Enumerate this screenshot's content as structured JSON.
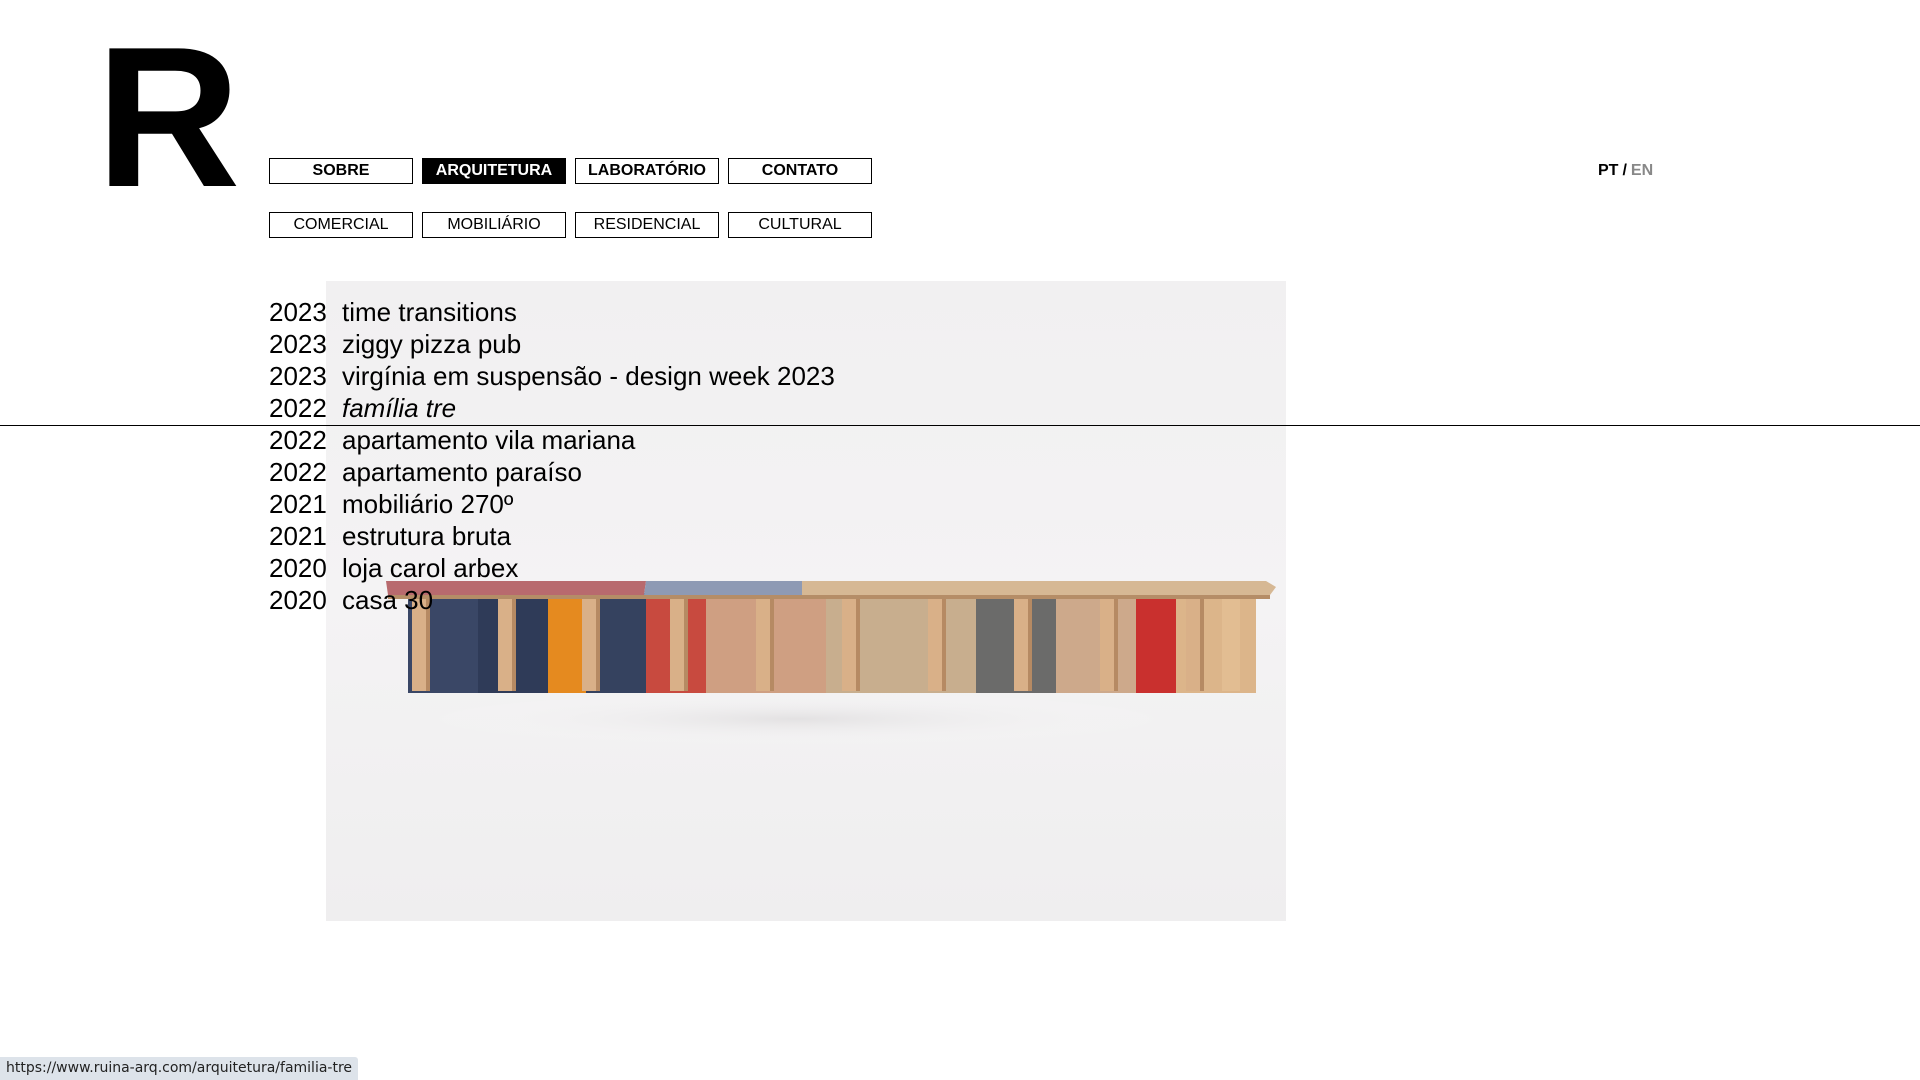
{
  "logo": "R",
  "nav": {
    "main": [
      {
        "label": "SOBRE",
        "active": false
      },
      {
        "label": "ARQUITETURA",
        "active": true
      },
      {
        "label": "LABORATÓRIO",
        "active": false
      },
      {
        "label": "CONTATO",
        "active": false
      }
    ],
    "sub": [
      {
        "label": "COMERCIAL"
      },
      {
        "label": "MOBILIÁRIO"
      },
      {
        "label": "RESIDENCIAL"
      },
      {
        "label": "CULTURAL"
      }
    ]
  },
  "language": {
    "current": "PT",
    "separator": "/",
    "other": "EN"
  },
  "projects": [
    {
      "year": "2023",
      "title": "time transitions",
      "hovered": false
    },
    {
      "year": "2023",
      "title": "ziggy pizza pub",
      "hovered": false
    },
    {
      "year": "2023",
      "title": "virgínia em suspensão - design week 2023",
      "hovered": false
    },
    {
      "year": "2022",
      "title": "família tre",
      "hovered": true
    },
    {
      "year": "2022",
      "title": "apartamento vila mariana",
      "hovered": false
    },
    {
      "year": "2022",
      "title": "apartamento paraíso",
      "hovered": false
    },
    {
      "year": "2021",
      "title": "mobiliário 270º",
      "hovered": false
    },
    {
      "year": "2021",
      "title": "estrutura bruta",
      "hovered": false
    },
    {
      "year": "2020",
      "title": "loja carol arbex",
      "hovered": false
    },
    {
      "year": "2020",
      "title": "casa 30",
      "hovered": false
    }
  ],
  "status_bar": {
    "url": "https://www.ruina-arq.com/arquitetura/familia-tre"
  }
}
